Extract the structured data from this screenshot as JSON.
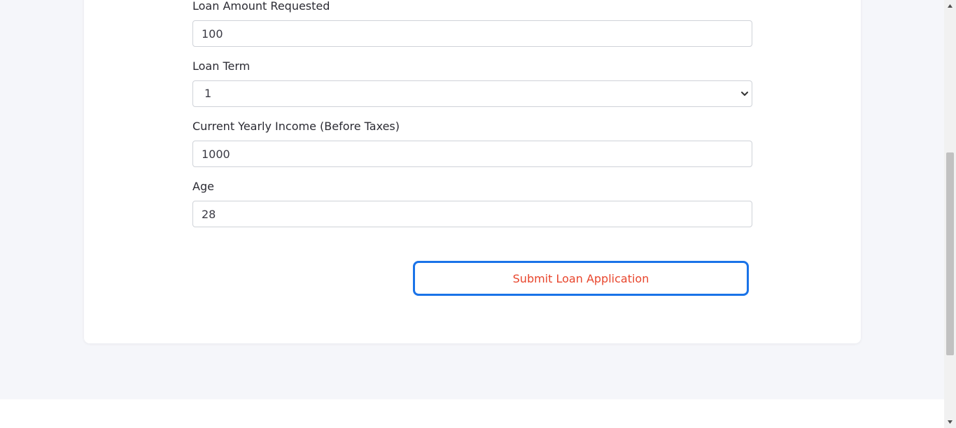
{
  "form": {
    "loan_amount": {
      "label": "Loan Amount Requested",
      "value": "100"
    },
    "loan_term": {
      "label": "Loan Term",
      "selected": "1"
    },
    "yearly_income": {
      "label": "Current Yearly Income (Before Taxes)",
      "value": "1000"
    },
    "age": {
      "label": "Age",
      "value": "28"
    },
    "submit_label": "Submit Loan Application"
  },
  "colors": {
    "background": "#f5f6fa",
    "card": "#ffffff",
    "button_border": "#1a73e8",
    "button_text": "#e8452c",
    "input_border": "#cfd2d8"
  },
  "icons": {
    "select_chevron": "chevron-down-icon",
    "scroll_up": "scroll-up-arrow-icon",
    "scroll_down": "scroll-down-arrow-icon"
  }
}
